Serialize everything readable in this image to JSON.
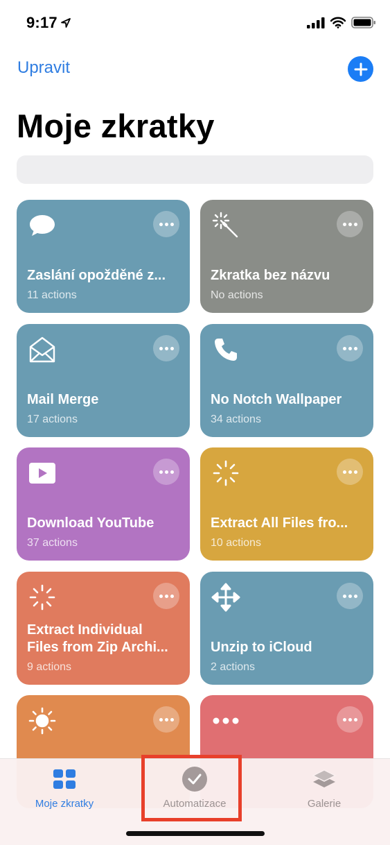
{
  "status": {
    "time": "9:17",
    "icons": [
      "location-arrow-icon",
      "signal-icon",
      "wifi-icon",
      "battery-icon"
    ]
  },
  "nav": {
    "edit_label": "Upravit",
    "add_icon": "plus-icon"
  },
  "title": "Moje zkratky",
  "search": {
    "placeholder": ""
  },
  "shortcuts": [
    {
      "name": "Zaslání opožděné z...",
      "count": "11 actions",
      "icon": "speech-bubble-icon",
      "color": "#6a9cb2"
    },
    {
      "name": "Zkratka bez názvu",
      "count": "No actions",
      "icon": "magic-wand-icon",
      "color": "#8a8d88"
    },
    {
      "name": "Mail Merge",
      "count": "17 actions",
      "icon": "envelope-open-icon",
      "color": "#6a9cb2"
    },
    {
      "name": "No Notch Wallpaper",
      "count": "34 actions",
      "icon": "phone-icon",
      "color": "#6a9cb2"
    },
    {
      "name": "Download YouTube",
      "count": "37 actions",
      "icon": "play-video-icon",
      "color": "#b274c2"
    },
    {
      "name": "Extract All Files fro...",
      "count": "10 actions",
      "icon": "spinner-icon",
      "color": "#d7a63f"
    },
    {
      "name": "Extract Individual\nFiles from Zip Archi...",
      "count": "9 actions",
      "icon": "spinner-icon",
      "color": "#e07b5e"
    },
    {
      "name": "Unzip to iCloud",
      "count": "2 actions",
      "icon": "move-arrows-icon",
      "color": "#6a9cb2"
    },
    {
      "name": "",
      "count": "",
      "icon": "sun-icon",
      "color": "#e08a4f"
    },
    {
      "name": "",
      "count": "",
      "icon": "ellipsis-icon",
      "color": "#e06f72"
    }
  ],
  "tabs": [
    {
      "label": "Moje zkratky",
      "icon": "grid-icon",
      "active": true
    },
    {
      "label": "Automatizace",
      "icon": "checkmark-circle-icon",
      "active": false
    },
    {
      "label": "Galerie",
      "icon": "layers-icon",
      "active": false
    }
  ],
  "colors": {
    "accent": "#2f7de1",
    "highlight": "#e8402b"
  }
}
